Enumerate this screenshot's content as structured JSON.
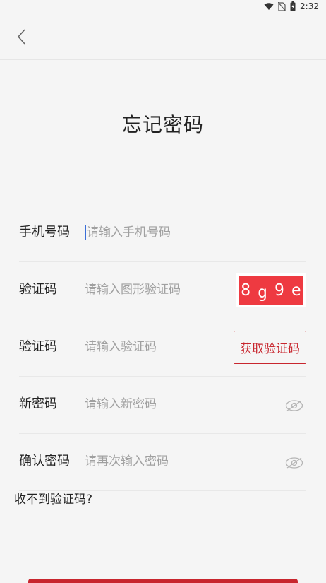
{
  "status_bar": {
    "time": "2:32",
    "icons": [
      "wifi-icon",
      "no-sim-icon",
      "battery-icon"
    ]
  },
  "header": {
    "back_icon": "chevron-left-icon"
  },
  "page": {
    "title": "忘记密码"
  },
  "form": {
    "phone": {
      "label": "手机号码",
      "placeholder": "请输入手机号码"
    },
    "image_captcha": {
      "label": "验证码",
      "placeholder": "请输入图形验证码",
      "chars": [
        "8",
        "g",
        "9",
        "e"
      ]
    },
    "sms_code": {
      "label": "验证码",
      "placeholder": "请输入验证码",
      "button_label": "获取验证码"
    },
    "new_password": {
      "label": "新密码",
      "placeholder": "请输入新密码",
      "toggle_icon": "eye-hidden-icon"
    },
    "confirm_password": {
      "label": "确认密码",
      "placeholder": "请再次输入密码",
      "toggle_icon": "eye-hidden-icon"
    }
  },
  "help": {
    "no_code_link": "收不到验证码?"
  },
  "colors": {
    "accent": "#c8262e",
    "captcha_bg": "#ee3a41",
    "background": "#f5f5f5",
    "cursor": "#3b6fd8"
  }
}
